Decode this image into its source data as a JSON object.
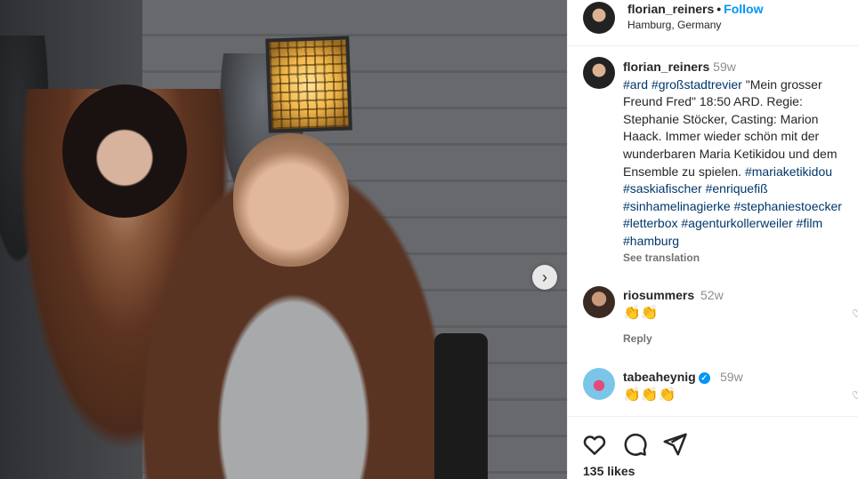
{
  "post": {
    "username": "florian_reiners",
    "follow_label": "Follow",
    "location": "Hamburg, Germany",
    "likes": "135 likes",
    "carousel_next_glyph": "›"
  },
  "caption": {
    "username": "florian_reiners",
    "time": "59w",
    "tags_before": "#ard #großstadtrevier",
    "text": "\"Mein grosser Freund Fred\" 18:50 ARD. Regie: Stephanie Stöcker, Casting: Marion Haack. Immer wieder schön mit der wunderbaren Maria Ketikidou und dem Ensemble zu spielen.",
    "tags_after": "#mariaketikidou #saskiafischer #enriquefiß #sinhamelinagierke #stephaniestoecker #letterbox #agenturkollerweiler #film #hamburg",
    "see_translation": "See translation"
  },
  "comments": [
    {
      "username": "riosummers",
      "time": "52w",
      "text": "👏👏",
      "reply": "Reply",
      "verified": false
    },
    {
      "username": "tabeaheynig",
      "time": "59w",
      "text": "👏👏👏",
      "reply": "",
      "verified": true
    }
  ],
  "icons": {
    "like": "heart-icon",
    "comment": "comment-icon",
    "share": "share-icon",
    "verified_glyph": "✓",
    "comment_like_glyph": "♡"
  }
}
